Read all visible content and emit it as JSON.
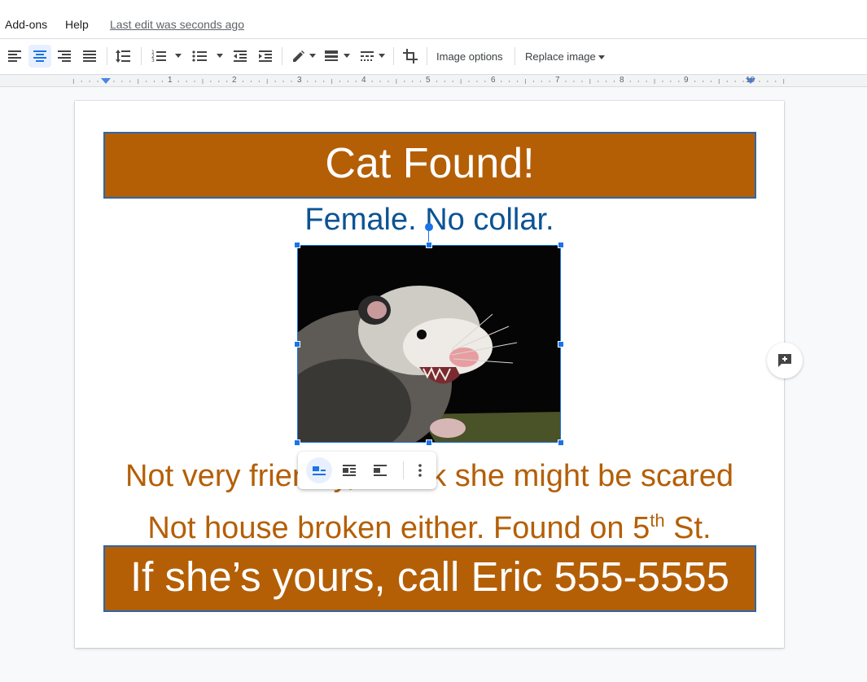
{
  "menu": {
    "items": [
      "Add-ons",
      "Help"
    ],
    "last_edit": "Last edit was seconds ago"
  },
  "toolbar": {
    "image_options_label": "Image options",
    "replace_image_label": "Replace image",
    "icons": [
      "align-left-icon",
      "align-center-icon",
      "align-right-icon",
      "align-justify-icon",
      "line-spacing-icon",
      "numbered-list-icon",
      "bulleted-list-icon",
      "decrease-indent-icon",
      "increase-indent-icon",
      "border-color-icon",
      "border-weight-icon",
      "border-dash-icon",
      "crop-icon"
    ],
    "active_alignment": "center"
  },
  "ruler": {
    "numbers": [
      "1",
      "2",
      "3",
      "4",
      "5",
      "6",
      "7",
      "8",
      "9",
      "10"
    ]
  },
  "document": {
    "title": "Cat Found!",
    "subtitle": "Female. No collar.",
    "line1": "Not very friendly, I think she might be scared",
    "line2_prefix": "Not house broken either. Found on 5",
    "line2_sup": "th",
    "line2_suffix": " St.",
    "footer": "If she’s yours, call Eric 555-5555",
    "image_subject": "opossum-photo"
  },
  "image_toolbar": {
    "icons": [
      "wrap-inline-icon",
      "wrap-text-icon",
      "break-text-icon",
      "more-options-icon"
    ],
    "active": "wrap-inline-icon"
  },
  "colors": {
    "banner": "#b45f06",
    "subtitle": "#0b5394",
    "body_text": "#b45f06",
    "selection": "#1a73e8"
  }
}
